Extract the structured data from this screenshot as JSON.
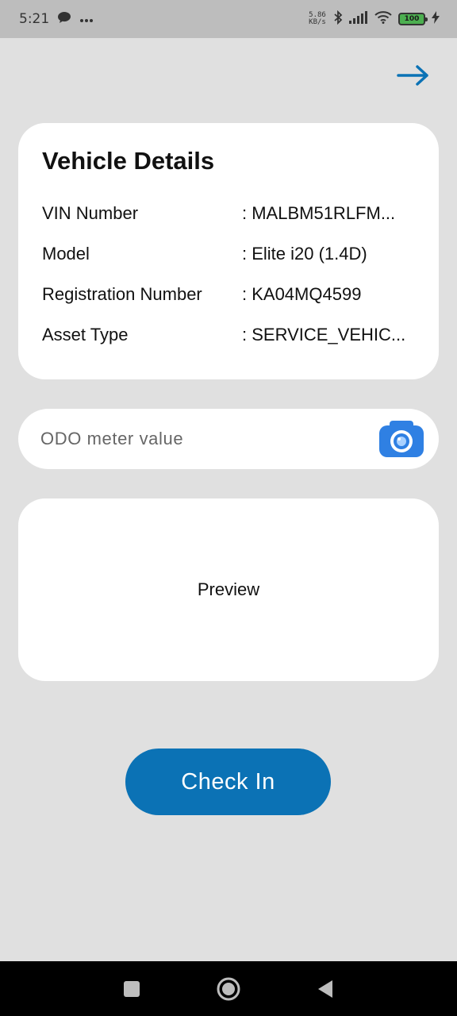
{
  "status_bar": {
    "time": "5:21",
    "net_speed_value": "5.86",
    "net_speed_unit": "KB/s",
    "battery_level": "100"
  },
  "details": {
    "title": "Vehicle Details",
    "rows": [
      {
        "label": "VIN Number",
        "value": ": MALBM51RLFM..."
      },
      {
        "label": "Model",
        "value": ": Elite i20 (1.4D)"
      },
      {
        "label": "Registration Number",
        "value": ": KA04MQ4599"
      },
      {
        "label": "Asset Type",
        "value": ": SERVICE_VEHIC..."
      }
    ]
  },
  "odo": {
    "placeholder": "ODO meter value",
    "value": ""
  },
  "preview": {
    "label": "Preview"
  },
  "actions": {
    "checkin_label": "Check In"
  },
  "colors": {
    "accent": "#0b72b5",
    "camera": "#2f80e3",
    "background": "#e0e0e0"
  }
}
